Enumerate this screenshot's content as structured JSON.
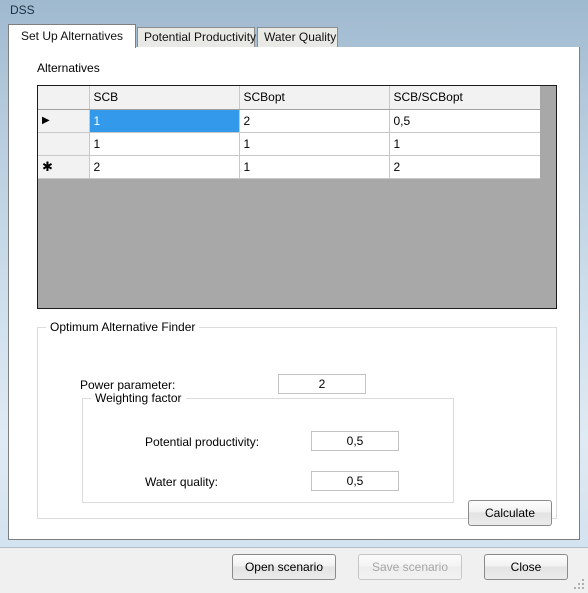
{
  "window": {
    "title": "DSS"
  },
  "tabs": [
    {
      "label": "Set Up Alternatives",
      "selected": true
    },
    {
      "label": "Potential Productivity",
      "selected": false
    },
    {
      "label": "Water Quality",
      "selected": false
    }
  ],
  "alternatives": {
    "label": "Alternatives",
    "columns": [
      "",
      "SCB",
      "SCBopt",
      "SCB/SCBopt"
    ],
    "rows": [
      {
        "marker": "arrow",
        "cells": [
          "1",
          "2",
          "0,5"
        ],
        "selected_cell_index": 0
      },
      {
        "marker": "",
        "cells": [
          "1",
          "1",
          "1"
        ],
        "selected_cell_index": -1
      },
      {
        "marker": "star",
        "cells": [
          "2",
          "1",
          "2"
        ],
        "selected_cell_index": -1
      }
    ],
    "markers": {
      "arrow": "▶",
      "star": "✱"
    }
  },
  "finder": {
    "title": "Optimum Alternative Finder",
    "power_parameter_label": "Power parameter:",
    "power_parameter_value": "2",
    "weighting": {
      "title": "Weighting factor",
      "potential_productivity_label": "Potential productivity:",
      "potential_productivity_value": "0,5",
      "water_quality_label": "Water quality:",
      "water_quality_value": "0,5"
    },
    "calculate_label": "Calculate"
  },
  "bottom_bar": {
    "open_scenario_label": "Open scenario",
    "save_scenario_label": "Save scenario",
    "save_scenario_disabled": true,
    "close_label": "Close"
  },
  "colors": {
    "selection_blue": "#3399ea",
    "grid_empty_grey": "#a8a8a8",
    "panel_white": "#ffffff",
    "titlebar_blue": "#b4cadc"
  }
}
